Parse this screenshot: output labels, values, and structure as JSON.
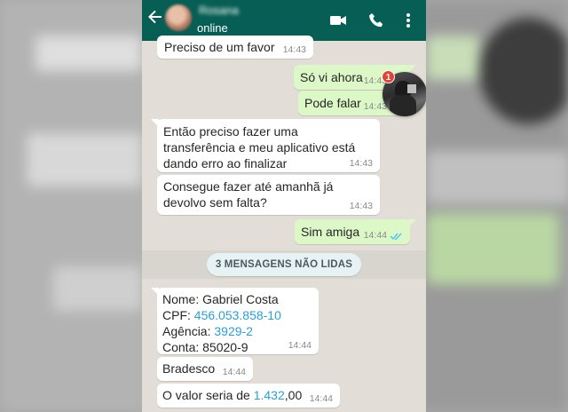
{
  "header": {
    "contact_name": "Rosana",
    "status": "online",
    "colors": {
      "bar": "#075e54"
    },
    "icons": [
      "back-arrow-icon",
      "video-call-icon",
      "phone-icon",
      "more-vert-icon"
    ]
  },
  "messages": [
    {
      "dir": "in",
      "text": "Preciso de um favor",
      "time": "14:43"
    },
    {
      "dir": "out",
      "text": "Só vi ahora",
      "time": "14:43",
      "read": true
    },
    {
      "dir": "out",
      "text": "Pode falar",
      "time": "14:43",
      "read": true
    },
    {
      "dir": "in",
      "lines": [
        "Então preciso fazer uma",
        "transferência e meu aplicativo está",
        "dando erro ao finalizar"
      ],
      "time": "14:43"
    },
    {
      "dir": "in",
      "lines": [
        "Consegue fazer até amanhã já",
        "devolvo sem falta?"
      ],
      "time": "14:43"
    },
    {
      "dir": "out",
      "text": "Sim amiga",
      "time": "14:44",
      "read": true
    }
  ],
  "unread_divider": "3 MENSAGENS NÃO LIDAS",
  "unread_messages": [
    {
      "dir": "in",
      "name_line": "Nome: Gabriel Costa",
      "cpf_label": "CPF: ",
      "cpf_value": "456.053.858-10",
      "agencia_label": "Agência: ",
      "agencia_value": "3929-2",
      "conta_line": "Conta: 85020-9",
      "time": "14:44"
    },
    {
      "dir": "in",
      "text": "Bradesco",
      "time": "14:44"
    },
    {
      "dir": "in",
      "text_before": "O valor seria de ",
      "amount": "1.432",
      "text_after": ",00",
      "time": "14:44"
    }
  ],
  "floating_chat_head": {
    "badge_count": "1"
  },
  "colors": {
    "chat_bg": "#e2ddd6",
    "bubble_in": "#ffffff",
    "bubble_out": "#dcf8c6",
    "link": "#2a9fd8",
    "read_ticks": "#4fc3f7",
    "badge": "#e54435"
  }
}
